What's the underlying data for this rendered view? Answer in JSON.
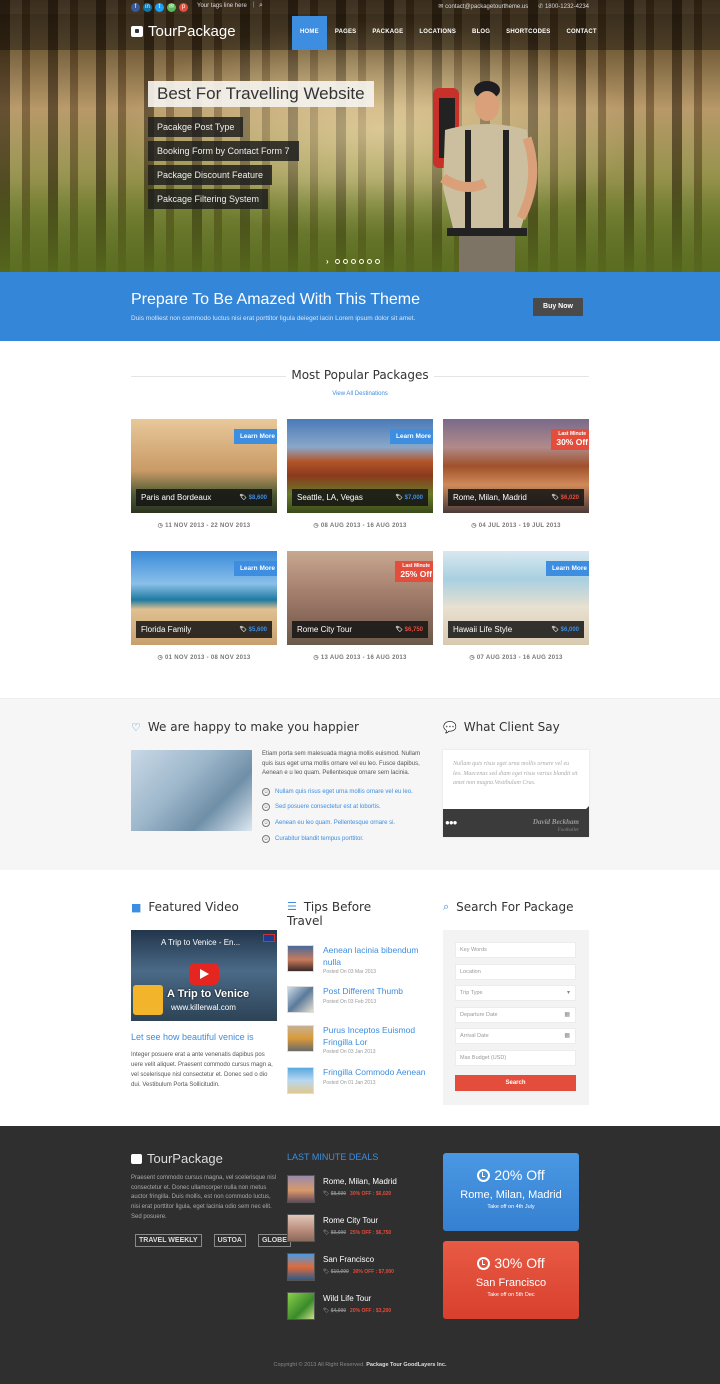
{
  "topbar": {
    "tagline": "Your tags line here",
    "email": "contact@packagetourtheme.us",
    "phone": "1800-1232-4234",
    "social": [
      {
        "name": "facebook",
        "glyph": "f",
        "color": "#3b5998"
      },
      {
        "name": "linkedin",
        "glyph": "in",
        "color": "#0e76a8"
      },
      {
        "name": "twitter",
        "glyph": "t",
        "color": "#1da1f2"
      },
      {
        "name": "email",
        "glyph": "✉",
        "color": "#5cb85c"
      },
      {
        "name": "pinterest",
        "glyph": "p",
        "color": "#e44c3b"
      }
    ]
  },
  "header": {
    "logo": "TourPackage",
    "nav": [
      "HOME",
      "PAGES",
      "PACKAGE",
      "LOCATIONS",
      "BLOG",
      "SHORTCODES",
      "CONTACT"
    ],
    "active": "HOME"
  },
  "hero": {
    "title": "Best For Travelling Website",
    "features": [
      "Pacakge Post Type",
      "Booking Form by Contact Form 7",
      "Package Discount Feature",
      "Pakcage Filtering System"
    ],
    "slide_count": 6
  },
  "band": {
    "title": "Prepare To Be Amazed With This Theme",
    "text": "Duis molliest non commodo luctus nisi erat porttitor ligula deieget lacin Lorem ipsum dolor sit amet.",
    "button": "Buy Now"
  },
  "popular": {
    "title": "Most Popular Packages",
    "view_all": "View All Destinations",
    "packages": [
      {
        "name": "Paris and Bordeaux",
        "price": "$8,600",
        "dates": "11 NOV 2013 - 22 NOV 2013",
        "badge": "Learn More",
        "type": "blue"
      },
      {
        "name": "Seattle, LA, Vegas",
        "price": "$7,000",
        "dates": "08 AUG 2013 - 16 AUG 2013",
        "badge": "Learn More",
        "type": "blue"
      },
      {
        "name": "Rome, Milan, Madrid",
        "price": "$6,020",
        "dates": "04 JUL 2013 - 19 JUL 2013",
        "badge_small": "Last Minute",
        "badge": "30% Off",
        "type": "red"
      },
      {
        "name": "Florida Family",
        "price": "$5,600",
        "dates": "01 NOV 2013 - 08 NOV 2013",
        "badge": "Learn More",
        "type": "blue"
      },
      {
        "name": "Rome City Tour",
        "price": "$6,750",
        "dates": "13 AUG 2013 - 16 AUG 2013",
        "badge_small": "Last Minute",
        "badge": "25% Off",
        "type": "red"
      },
      {
        "name": "Hawaii Life Style",
        "price": "$6,000",
        "dates": "07 AUG 2013 - 16 AUG 2013",
        "badge": "Learn More",
        "type": "blue"
      }
    ]
  },
  "happy": {
    "title": "We are happy to make you happier",
    "text": "Etiam porta sem malesuada magna mollis euismod. Nullam quis isus eget urna mollis ornare vel eu leo. Fusce dapibus, Aenean e u leo quam. Pellentesque ornare sem lacinia.",
    "list": [
      "Nullam quis risus eget urna mollis ornare vel eu leo.",
      "Sed posuere consectetur est at lobortis.",
      "Aenean eu leo quam. Pellentesque ornare si.",
      "Curabitur blandit tempus porttitor."
    ]
  },
  "testimonial": {
    "title": "What Client Say",
    "quote": "Nullam quis risus eget urna mollis ornare vel eu leo. Maecenas sed diam eget risus varius blandit sit amet non magna.Vestibulum Cras.",
    "author": "David Beckham",
    "role": "Footballer"
  },
  "video": {
    "title": "Featured Video",
    "video_title": "A Trip to Venice - En...",
    "overlay": "A Trip to Venice",
    "url": "www.killerwal.com",
    "heading": "Let see how beautiful venice is",
    "text": "Integer posuere erat a ante venenatis dapibus pos uere velit aliquet. Praesent commodo cursus magn a, vel scelerisque nisl consectetur et. Donec sed o dio dui. Vestibulum Porta Sollicitudin."
  },
  "tips": {
    "title_line1": "Tips Before",
    "title_line2": "Travel",
    "items": [
      {
        "title": "Aenean lacinia bibendum nulla",
        "date": "Posted On 03 Mar 2013"
      },
      {
        "title": "Post Different Thumb",
        "date": "Posted On 03 Feb 2013"
      },
      {
        "title": "Purus Inceptos Euismod Fringilla Lor",
        "date": "Posted On 03 Jan 2013"
      },
      {
        "title": "Fringilla Commodo Aenean",
        "date": "Posted On 01 Jan 2013"
      }
    ]
  },
  "search": {
    "title": "Search For Package",
    "fields": {
      "keywords": "Key Words",
      "location": "Location",
      "trip_type": "Trip Type",
      "departure": "Departure Date",
      "arrival": "Arrival Date",
      "budget": "Max Budget (USD)"
    },
    "button": "Search"
  },
  "footer": {
    "logo": "TourPackage",
    "text": "Praesent commodo cursus magna, vel scelerisque nisl consectetur et. Donec ullamcorper nulla non metus auctor fringilla. Duis mollis, est non commodo luctus, nisi erat porttitor ligula, eget lacinia odio sem nec elit. Sed posuere.",
    "partners": [
      "TRAVEL WEEKLY",
      "USTOA",
      "GLOBE"
    ],
    "deals_title": "LAST MINUTE DEALS",
    "deals": [
      {
        "name": "Rome, Milan, Madrid",
        "old": "$8,600",
        "offer": "30% OFF : $6,020"
      },
      {
        "name": "Rome City Tour",
        "old": "$9,000",
        "offer": "25% OFF : $6,750"
      },
      {
        "name": "San Francisco",
        "old": "$10,000",
        "offer": "30% OFF : $7,000"
      },
      {
        "name": "Wild Life Tour",
        "old": "$4,000",
        "offer": "20% OFF : $3,200"
      }
    ],
    "promos": [
      {
        "pct": "20% Off",
        "place": "Rome, Milan, Madrid",
        "sub": "Take off on 4th July",
        "color": "#3d8de0"
      },
      {
        "pct": "30% Off",
        "place": "San Francisco",
        "sub": "Take off on 5th Dec",
        "color": "#e04a38"
      }
    ],
    "copyright": "Copyright © 2013 All Right Reserved.",
    "company": "Package Tour GoodLayers Inc."
  },
  "colors": {
    "accent": "#3d8de0",
    "red": "#e44c3b",
    "dark": "#2f2f2f"
  }
}
